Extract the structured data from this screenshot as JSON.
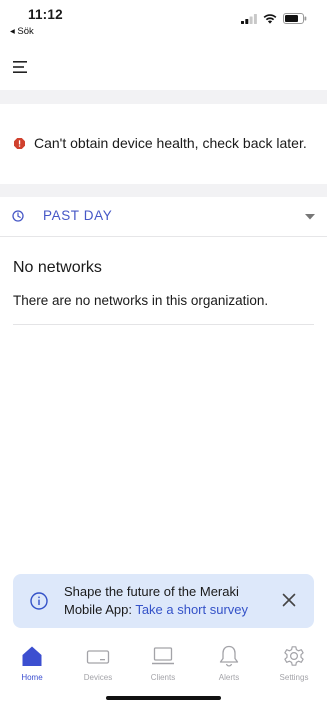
{
  "status_bar": {
    "time": "11:12",
    "back_label": "◂ Sök"
  },
  "health": {
    "message": "Can't obtain device health, check back later.",
    "icon": "error-octagon-icon",
    "icon_color": "#d0412e"
  },
  "timeframe": {
    "label": "PAST DAY",
    "accent_color": "#4657c6"
  },
  "networks": {
    "title": "No networks",
    "message": "There are no networks in this organization."
  },
  "survey": {
    "text": "Shape the future of the Meraki Mobile App: ",
    "link_label": "Take a short survey",
    "background": "#dde8fa"
  },
  "tabs": [
    {
      "label": "Home",
      "icon": "home-icon",
      "active": true
    },
    {
      "label": "Devices",
      "icon": "devices-icon",
      "active": false
    },
    {
      "label": "Clients",
      "icon": "clients-icon",
      "active": false
    },
    {
      "label": "Alerts",
      "icon": "bell-icon",
      "active": false
    },
    {
      "label": "Settings",
      "icon": "gear-icon",
      "active": false
    }
  ],
  "colors": {
    "active_tab": "#3c4fd0",
    "inactive_tab": "#a3a3a8"
  }
}
